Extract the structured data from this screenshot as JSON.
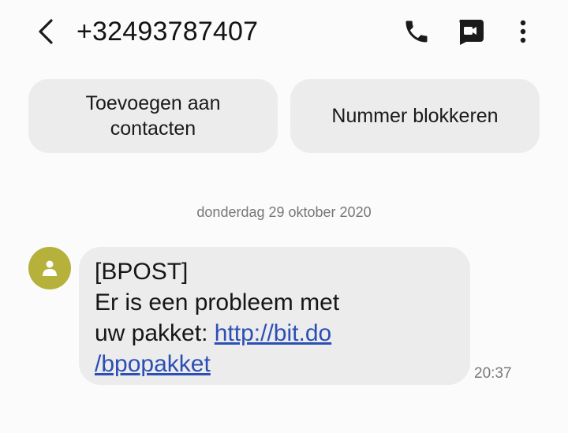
{
  "header": {
    "phone_number": "+32493787407",
    "icons": {
      "back": "chevron-left-icon",
      "call": "phone-icon",
      "video": "video-call-icon",
      "more": "more-vertical-icon"
    }
  },
  "actions": {
    "add_contact_line1": "Toevoegen aan",
    "add_contact_line2": "contacten",
    "block_number": "Nummer blokkeren"
  },
  "conversation": {
    "date_separator": "donderdag 29 oktober 2020",
    "message": {
      "avatar_icon": "person-icon",
      "avatar_color": "#b5b13a",
      "line1": "[BPOST]",
      "line2": "Er is een probleem met",
      "line3_prefix": "uw pakket: ",
      "link_part1": "http://bit.do",
      "link_part2": "/bpopakket",
      "time": "20:37"
    }
  },
  "colors": {
    "link": "#2b4fb5",
    "bubble": "#ececec",
    "background": "#fbfbfb"
  }
}
